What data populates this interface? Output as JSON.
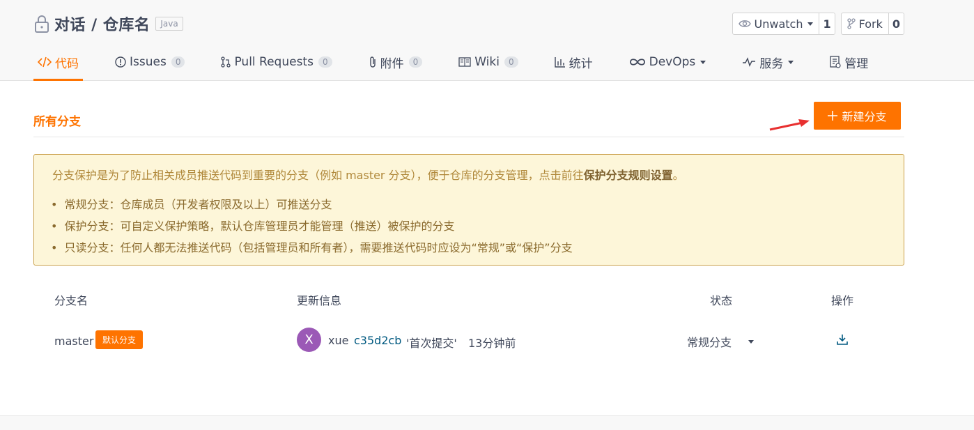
{
  "repo": {
    "title": "对话 / 仓库名",
    "language": "Java"
  },
  "actions": {
    "watch_label": "Unwatch",
    "watch_count": "1",
    "fork_label": "Fork",
    "fork_count": "0"
  },
  "tabs": [
    {
      "label": "代码",
      "icon": "code-icon",
      "active": true
    },
    {
      "label": "Issues",
      "count": "0",
      "icon": "issue-icon"
    },
    {
      "label": "Pull Requests",
      "count": "0",
      "icon": "pull-request-icon"
    },
    {
      "label": "附件",
      "count": "0",
      "icon": "paperclip-icon"
    },
    {
      "label": "Wiki",
      "count": "0",
      "icon": "book-icon"
    },
    {
      "label": "统计",
      "icon": "bar-chart-icon"
    },
    {
      "label": "DevOps",
      "icon": "infinity-icon"
    },
    {
      "label": "服务",
      "icon": "pulse-icon"
    },
    {
      "label": "管理",
      "icon": "settings-doc-icon"
    }
  ],
  "section": {
    "title": "所有分支",
    "new_branch_label": "新建分支"
  },
  "notice": {
    "intro": "分支保护是为了防止相关成员推送代码到重要的分支（例如 master 分支），便于仓库的分支管理，点击前往",
    "intro_link": "保护分支规则设置",
    "intro_end": "。",
    "items": [
      "常规分支：仓库成员（开发者权限及以上）可推送分支",
      "保护分支：可自定义保护策略，默认仓库管理员才能管理（推送）被保护的分支",
      "只读分支：任何人都无法推送代码（包括管理员和所有者），需要推送代码时应设为“常规”或“保护”分支"
    ]
  },
  "table": {
    "headers": {
      "name": "分支名",
      "update": "更新信息",
      "status": "状态",
      "action": "操作"
    },
    "rows": [
      {
        "name": "master",
        "badge": "默认分支",
        "avatar_letter": "X",
        "author": "xue",
        "sha": "c35d2cb",
        "message": "'首次提交'",
        "time": "13分钟前",
        "status": "常规分支"
      }
    ]
  },
  "colors": {
    "accent": "#fe7300",
    "notice_bg": "#fdf6d9",
    "avatar": "#9b59b6"
  }
}
